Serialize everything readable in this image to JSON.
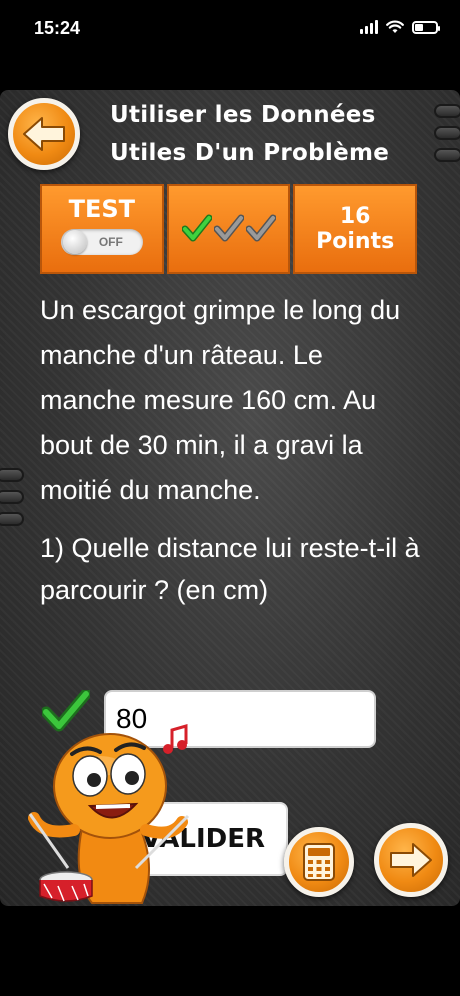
{
  "status_bar": {
    "time": "15:24"
  },
  "header": {
    "title_line_1": "Utiliser les Données",
    "title_line_2": "Utiles D'un Problème"
  },
  "score_bar": {
    "test_label": "TEST",
    "toggle_state": "OFF",
    "checks": {
      "correct": 1,
      "total": 3,
      "correct_color": "#2fb52f",
      "pending_color": "#8a8a8a"
    },
    "points_value": "16",
    "points_label": "Points"
  },
  "problem": {
    "statement": "Un escargot grimpe le long du manche d'un râteau. Le manche mesure 160 cm. Au bout de 30 min, il a gravi la moitié du manche.",
    "question": "1) Quelle distance lui reste-t-il à parcourir ? (en cm)"
  },
  "answer": {
    "value": "80",
    "status": "correct"
  },
  "buttons": {
    "validate_label": "VALIDER"
  },
  "icons": {
    "back": "arrow-left-icon",
    "next": "arrow-right-icon",
    "calculator": "calculator-icon",
    "answer_status": "checkmark-icon"
  },
  "colors": {
    "accent": "#f08a13",
    "background": "#333333",
    "check_green": "#2fb52f"
  }
}
